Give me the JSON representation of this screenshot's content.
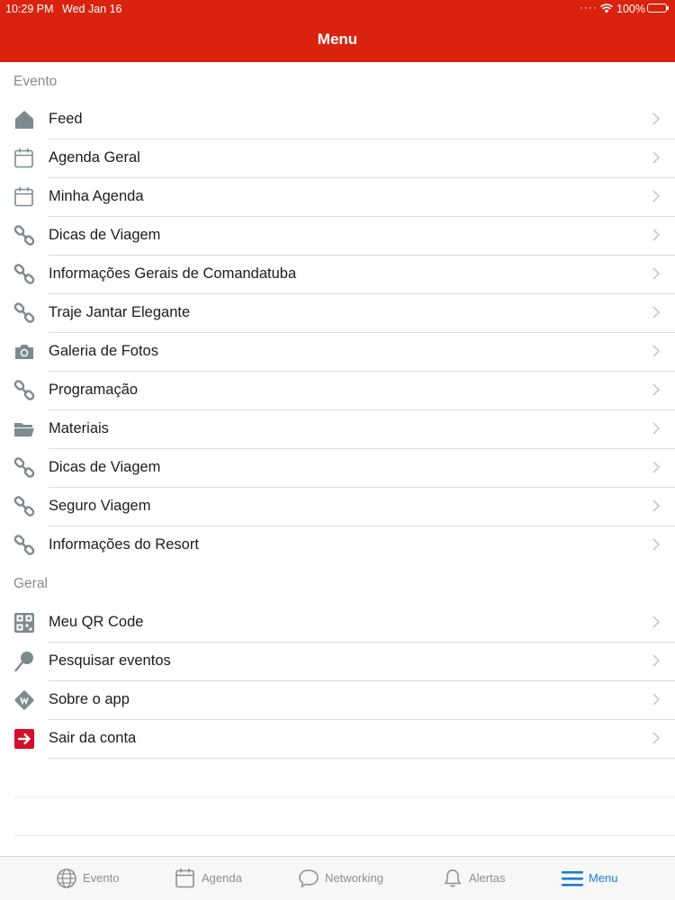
{
  "status_bar": {
    "time": "10:29 PM",
    "date": "Wed Jan 16",
    "battery": "100%"
  },
  "nav": {
    "title": "Menu"
  },
  "sections": [
    {
      "header": "Evento",
      "items": [
        {
          "label": "Feed",
          "icon": "home-icon"
        },
        {
          "label": "Agenda Geral",
          "icon": "calendar-icon"
        },
        {
          "label": "Minha Agenda",
          "icon": "calendar-icon"
        },
        {
          "label": "Dicas de Viagem",
          "icon": "link-icon"
        },
        {
          "label": "Informações Gerais de Comandatuba",
          "icon": "link-icon"
        },
        {
          "label": "Traje Jantar Elegante",
          "icon": "link-icon"
        },
        {
          "label": "Galeria de Fotos",
          "icon": "camera-icon"
        },
        {
          "label": "Programação",
          "icon": "link-icon"
        },
        {
          "label": "Materiais",
          "icon": "folder-icon"
        },
        {
          "label": "Dicas de Viagem",
          "icon": "link-icon"
        },
        {
          "label": "Seguro Viagem",
          "icon": "link-icon"
        },
        {
          "label": "Informações do Resort",
          "icon": "link-icon"
        }
      ]
    },
    {
      "header": "Geral",
      "items": [
        {
          "label": "Meu QR Code",
          "icon": "qr-code-icon"
        },
        {
          "label": "Pesquisar eventos",
          "icon": "search-pin-icon"
        },
        {
          "label": "Sobre o app",
          "icon": "info-badge-icon"
        },
        {
          "label": "Sair da conta",
          "icon": "logout-icon"
        }
      ]
    }
  ],
  "tabbar": {
    "tabs": [
      {
        "label": "Evento",
        "icon": "globe-icon",
        "active": false
      },
      {
        "label": "Agenda",
        "icon": "calendar-icon",
        "active": false
      },
      {
        "label": "Networking",
        "icon": "chat-bubble-icon",
        "active": false
      },
      {
        "label": "Alertas",
        "icon": "bell-icon",
        "active": false
      },
      {
        "label": "Menu",
        "icon": "hamburger-menu-icon",
        "active": true
      }
    ]
  },
  "colors": {
    "brand_red": "#d9230f",
    "active_tab": "#1b7cd6",
    "icon_gray": "#7d8a8f",
    "logout_red": "#d4102c"
  }
}
